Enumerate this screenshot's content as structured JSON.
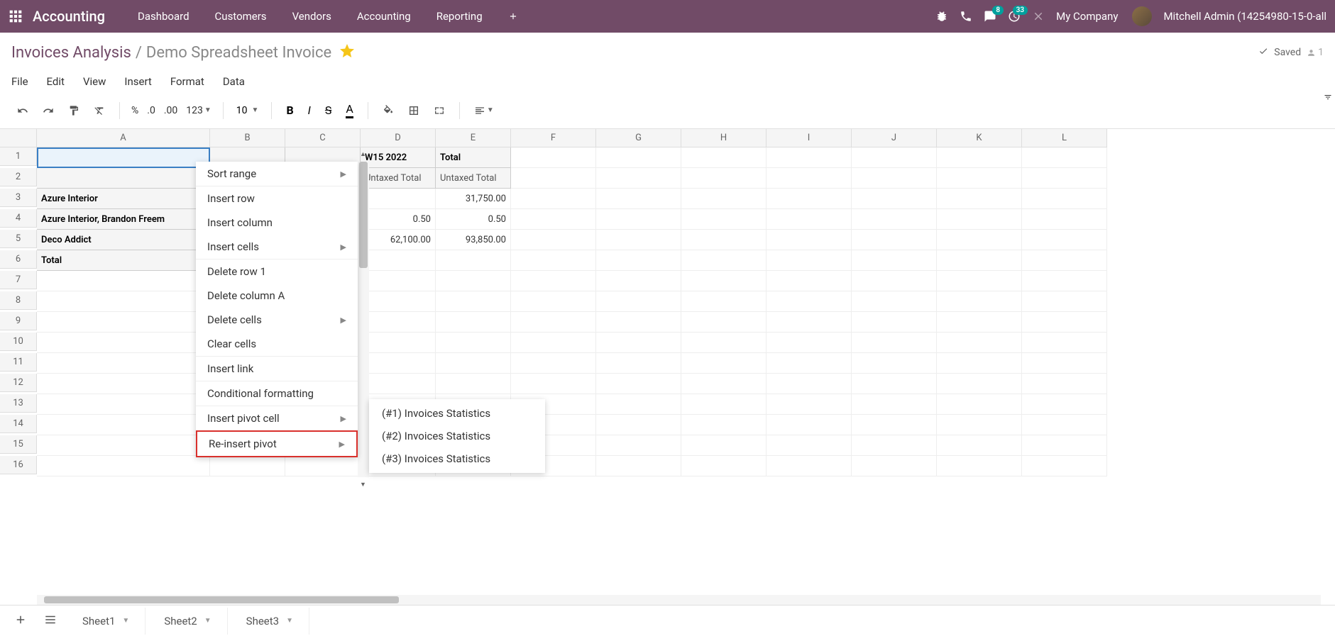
{
  "topnav": {
    "brand": "Accounting",
    "items": [
      "Dashboard",
      "Customers",
      "Vendors",
      "Accounting",
      "Reporting"
    ],
    "badges": {
      "chat": "8",
      "activity": "33"
    },
    "company": "My Company",
    "user": "Mitchell Admin (14254980-15-0-all"
  },
  "breadcrumb": {
    "parent": "Invoices Analysis",
    "current": "Demo Spreadsheet Invoice",
    "saved": "Saved",
    "users": "1"
  },
  "menubar": [
    "File",
    "Edit",
    "View",
    "Insert",
    "Format",
    "Data"
  ],
  "toolbar": {
    "pct": "%",
    "dec0": ".0",
    "dec00": ".00",
    "n123": "123",
    "fontsize": "10",
    "bold": "B",
    "italic": "I",
    "strike": "S",
    "color": "A"
  },
  "columns": [
    "A",
    "B",
    "C",
    "D",
    "E",
    "F",
    "G",
    "H",
    "I",
    "J",
    "K",
    "L"
  ],
  "rows": [
    "1",
    "2",
    "3",
    "4",
    "5",
    "6",
    "7",
    "8",
    "9",
    "10",
    "11",
    "12",
    "13",
    "14",
    "15",
    "16"
  ],
  "cells": {
    "d1": "W15 2022",
    "e1": "Total",
    "d2": "Untaxed Total",
    "e2": "Untaxed Total",
    "a3": "Azure Interior",
    "e3": "31,750.00",
    "a4": "Azure Interior, Brandon Freem",
    "d4": "0.50",
    "e4": "0.50",
    "a5": "Deco Addict",
    "d5": "62,100.00",
    "e5": "93,850.00",
    "a6": "Total"
  },
  "context_menu": {
    "sort": "Sort range",
    "ins_row": "Insert row",
    "ins_col": "Insert column",
    "ins_cells": "Insert cells",
    "del_row": "Delete row 1",
    "del_col": "Delete column A",
    "del_cells": "Delete cells",
    "clear": "Clear cells",
    "link": "Insert link",
    "cond": "Conditional formatting",
    "pivot_cell": "Insert pivot cell",
    "reinsert": "Re-insert pivot"
  },
  "submenu": [
    "(#1) Invoices Statistics",
    "(#2) Invoices Statistics",
    "(#3) Invoices Statistics"
  ],
  "tabs": [
    "Sheet1",
    "Sheet2",
    "Sheet3"
  ]
}
